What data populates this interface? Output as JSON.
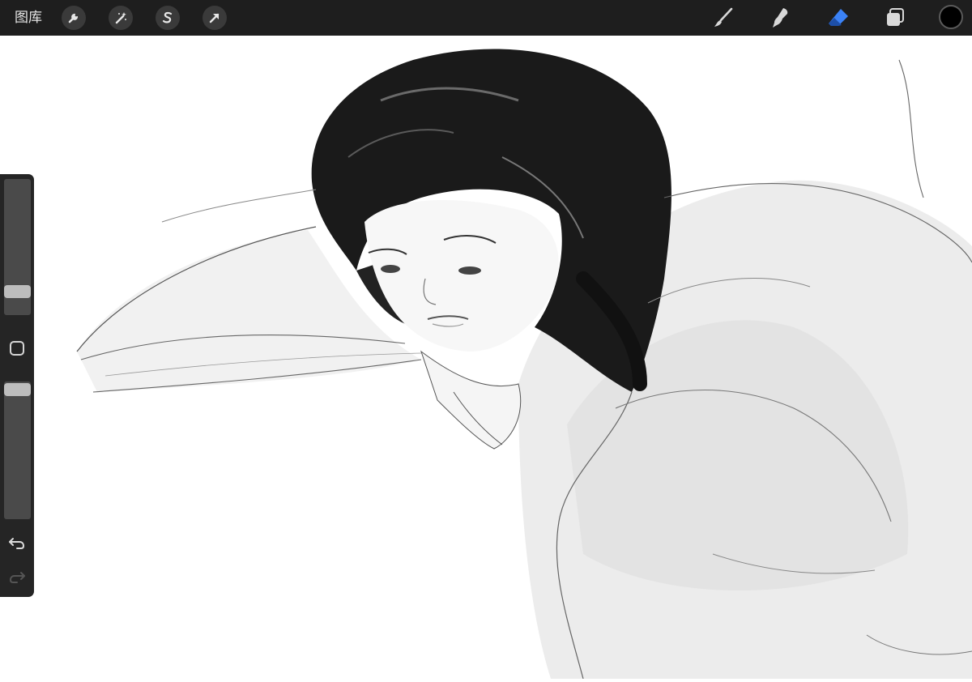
{
  "toolbar": {
    "gallery_label": "图库",
    "left_tools": [
      {
        "icon": "wrench-icon"
      },
      {
        "icon": "magic-wand-icon"
      },
      {
        "icon": "selection-s-icon"
      },
      {
        "icon": "transform-arrow-icon"
      }
    ],
    "right_tools": [
      {
        "icon": "brush-icon"
      },
      {
        "icon": "smudge-icon"
      },
      {
        "icon": "eraser-icon",
        "active": true
      },
      {
        "icon": "layers-icon"
      }
    ],
    "current_color": "#000000",
    "accent_color": "#3b82f6"
  },
  "sidebar": {
    "brush_size": 0.13,
    "opacity": 0.98,
    "icons": [
      "modify-square-icon",
      "undo-icon",
      "redo-icon"
    ]
  },
  "canvas": {
    "description_icon": "sketch-artwork"
  }
}
